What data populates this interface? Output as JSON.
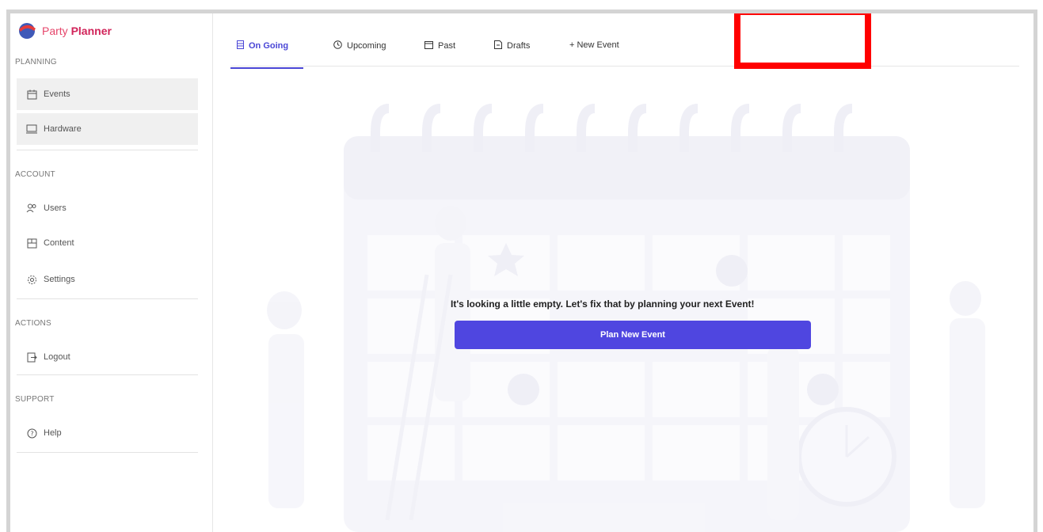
{
  "app": {
    "logo_text_a": "Party",
    "logo_text_b": "Planner"
  },
  "sidebar": {
    "sections": [
      {
        "label": "PLANNING"
      },
      {
        "label": "ACCOUNT"
      },
      {
        "label": "ACTIONS"
      },
      {
        "label": "SUPPORT"
      }
    ],
    "items": [
      {
        "label": "Events",
        "icon": "calendar-icon"
      },
      {
        "label": "Hardware",
        "icon": "laptop-icon"
      },
      {
        "label": "Users",
        "icon": "users-icon"
      },
      {
        "label": "Content",
        "icon": "content-icon"
      },
      {
        "label": "Settings",
        "icon": "gear-icon"
      },
      {
        "label": "Logout",
        "icon": "logout-icon"
      },
      {
        "label": "Help",
        "icon": "help-icon"
      }
    ]
  },
  "tabs": [
    {
      "label": "On Going",
      "icon": "list-icon",
      "active": true
    },
    {
      "label": "Upcoming",
      "icon": "clock-icon"
    },
    {
      "label": "Past",
      "icon": "calendar-icon"
    },
    {
      "label": "Drafts",
      "icon": "draft-icon"
    },
    {
      "label": "+ New Event",
      "icon": "plus-icon"
    }
  ],
  "empty_state": {
    "message": "It's looking a little empty. Let's fix that by planning your next Event!",
    "button_label": "Plan New Event"
  },
  "colors": {
    "accent": "#4f46e0",
    "highlight": "#ff0000",
    "brand": "#d1245a"
  }
}
